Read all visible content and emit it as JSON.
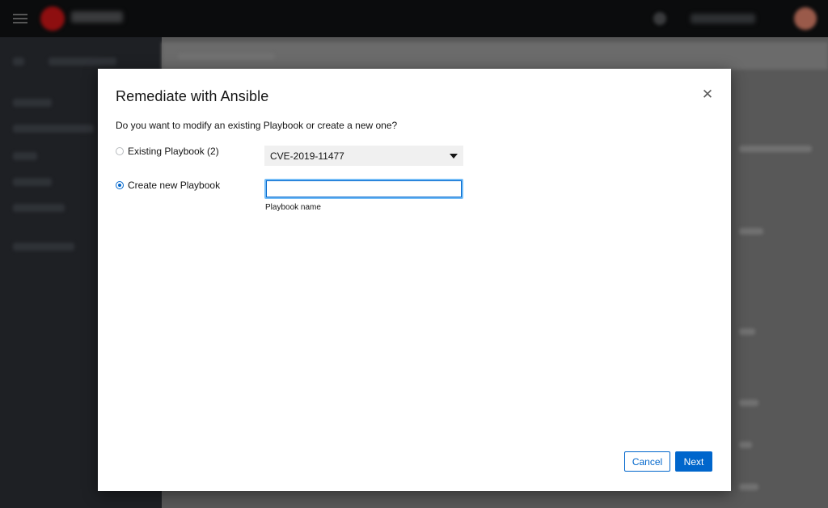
{
  "modal": {
    "title": "Remediate with Ansible",
    "question": "Do you want to modify an existing Playbook or create a new one?",
    "options": [
      {
        "label": "Existing Playbook (2)",
        "checked": false
      },
      {
        "label": "Create new Playbook",
        "checked": true
      }
    ],
    "playbook_select": {
      "selected": "CVE-2019-11477"
    },
    "playbook_name": {
      "value": "",
      "placeholder": "",
      "helper": "Playbook name"
    },
    "buttons": {
      "cancel": "Cancel",
      "next": "Next"
    }
  },
  "icons": {
    "close": "close-icon",
    "caret": "caret-down-icon",
    "menu": "hamburger-icon"
  },
  "colors": {
    "primary": "#0066cc",
    "focus": "#73bcf7",
    "select_bg": "#f0f0f0",
    "text": "#151515"
  }
}
